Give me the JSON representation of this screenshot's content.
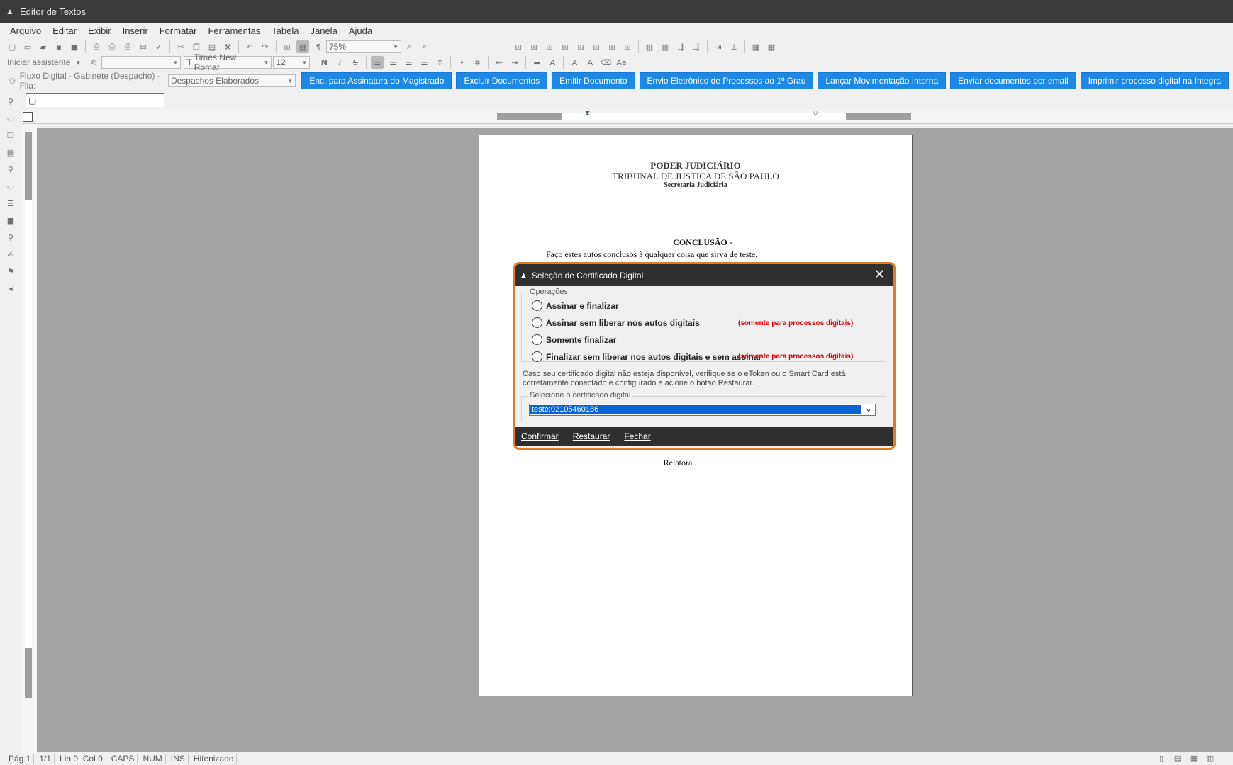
{
  "window": {
    "title": "Editor de Textos"
  },
  "menu": [
    "Arquivo",
    "Editar",
    "Exibir",
    "Inserir",
    "Formatar",
    "Ferramentas",
    "Tabela",
    "Janela",
    "Ajuda"
  ],
  "format_toolbar": {
    "assistant_label": "Iniciar assistente",
    "style_value": "",
    "font_value": "Times New Romar",
    "size_value": "12",
    "zoom_value": "75%",
    "bold": "N",
    "italic": "I",
    "strike": "S"
  },
  "flow_bar": {
    "label": "Fluxo Digital - Gabinete (Despacho) - Fila:",
    "queue_value": "Despachos Elaborados",
    "buttons": [
      "Enc. para Assinatura do Magistrado",
      "Excluir Documentos",
      "Emitir Documento",
      "Envio Eletrônico de Processos ao 1º Grau",
      "Lançar Movimentação Interna",
      "Enviar documentos por email",
      "Imprimir processo digital na íntegra"
    ]
  },
  "document": {
    "header1": "PODER JUDICIÁRIO",
    "header2": "TRIBUNAL DE JUSTIÇA DE SÃO PAULO",
    "header3": "Secretaria Judiciária",
    "conclusao": "CONCLUSÃO -",
    "body": "Faço estes autos conclusos à qualquer coisa que sirva de teste.",
    "footer": "Relatora"
  },
  "dialog": {
    "title": "Seleção de Certificado Digital",
    "operations_label": "Operações",
    "options": [
      "Assinar e finalizar",
      "Assinar sem liberar nos autos digitais",
      "Somente finalizar",
      "Finalizar sem liberar nos autos digitais e sem assinar"
    ],
    "warning": "(somente para processos digitais)",
    "info": "Caso seu certificado digital não esteja disponível, verifique se o eToken ou o Smart Card está corretamente conectado e configurado e acione o botão Restaurar.",
    "cert_label": "Selecione o certificado digital",
    "cert_value": "teste:02105460186",
    "confirm": "Confirmar",
    "restore": "Restaurar",
    "close": "Fechar"
  },
  "status": [
    "Pág 1",
    "1/1",
    "Lin 0  Col 0",
    "CAPS",
    "NUM",
    "INS",
    "Hifenizado"
  ],
  "colors": {
    "accent": "#1e88e5",
    "dialog_border": "#e87a1e",
    "warning": "#e00000",
    "titlebar": "#3a3a3a"
  }
}
